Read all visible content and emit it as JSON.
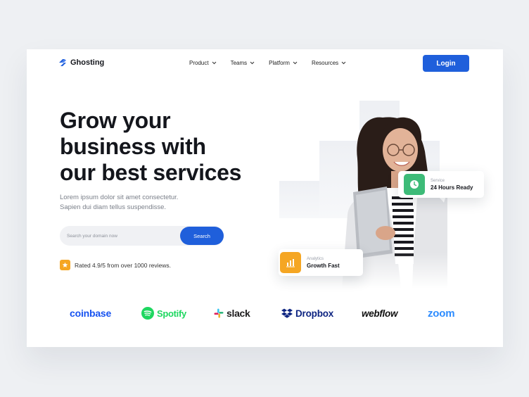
{
  "header": {
    "logo_name": "Ghosting",
    "nav": [
      {
        "label": "Product"
      },
      {
        "label": "Teams"
      },
      {
        "label": "Platform"
      },
      {
        "label": "Resources"
      }
    ],
    "login_label": "Login"
  },
  "hero": {
    "headline_lines": [
      "Grow your",
      "business with",
      "our best services"
    ],
    "subtext_lines": [
      "Lorem ipsum dolor sit amet consectetur.",
      "Sapien dui diam tellus suspendisse."
    ],
    "search": {
      "placeholder": "Search your domain now",
      "value": "",
      "button_label": "Search"
    },
    "rating_text": "Rated 4.9/5 from over 1000 reviews."
  },
  "cards": {
    "service": {
      "label": "Service",
      "value": "24 Hours Ready"
    },
    "analytics": {
      "label": "Analytics",
      "value": "Growth Fast"
    }
  },
  "brands": [
    {
      "name": "coinbase",
      "color": "#1652f0"
    },
    {
      "name": "Spotify",
      "color": "#1ed760"
    },
    {
      "name": "slack",
      "color": "#1d1c1d"
    },
    {
      "name": "Dropbox",
      "color": "#0d2481"
    },
    {
      "name": "webflow",
      "color": "#111111"
    },
    {
      "name": "zoom",
      "color": "#2d8cff"
    }
  ],
  "colors": {
    "accent": "#1f5fdb",
    "star": "#f5a623",
    "service_icon": "#3dbb78",
    "analytics_icon": "#f5a623"
  },
  "icons": {
    "logo": "ghosting-logo-icon",
    "nav_dropdown": "chevron-down-icon",
    "star": "star-icon",
    "clock": "clock-icon",
    "chart": "bar-chart-icon"
  }
}
